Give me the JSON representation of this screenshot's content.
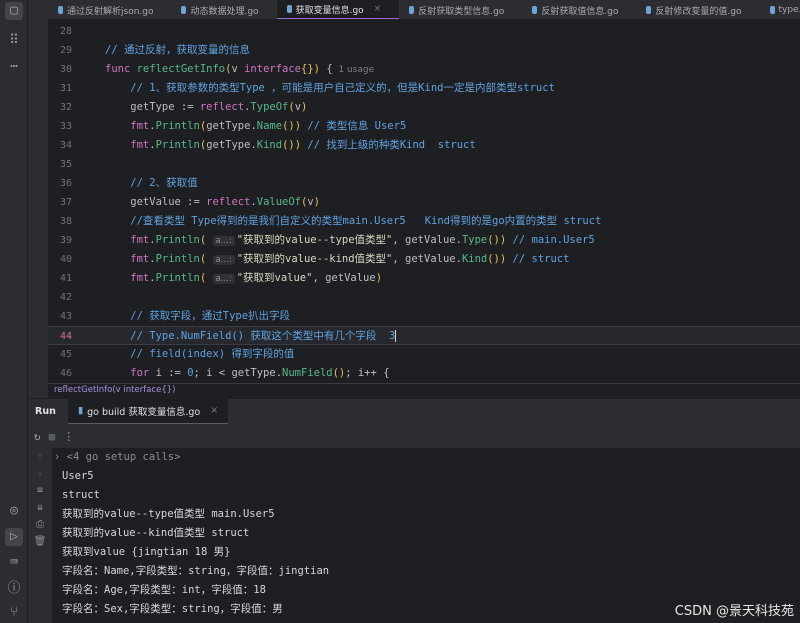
{
  "tabs": [
    {
      "label": "通过反射解析json.go",
      "active": false
    },
    {
      "label": "动态数据处理.go",
      "active": false
    },
    {
      "label": "获取变量信息.go",
      "active": true
    },
    {
      "label": "反射获取类型信息.go",
      "active": false
    },
    {
      "label": "反射获取值信息.go",
      "active": false
    },
    {
      "label": "反射修改变量的值.go",
      "active": false
    },
    {
      "label": "type.go",
      "active": false
    }
  ],
  "tab_close": "×",
  "code": [
    {
      "n": "28",
      "tokens": []
    },
    {
      "n": "29",
      "tokens": [
        [
          "// 通过反射，获取变量的信息",
          "c"
        ]
      ]
    },
    {
      "n": "30",
      "tokens": [
        [
          "func ",
          "k"
        ],
        [
          "reflectGetInfo",
          "f"
        ],
        [
          "(",
          "p"
        ],
        [
          "v ",
          "t"
        ],
        [
          "interface",
          "k"
        ],
        [
          "{}",
          "p"
        ],
        [
          ")",
          "p"
        ],
        [
          " {",
          "t"
        ],
        [
          "  1 usage",
          "h"
        ]
      ]
    },
    {
      "n": "31",
      "tokens": [
        [
          "    // 1、获取参数的类型Type ，可能是用户自己定义的，但是Kind一定是内部类型struct",
          "c"
        ]
      ]
    },
    {
      "n": "32",
      "tokens": [
        [
          "    getType := ",
          "t"
        ],
        [
          "reflect",
          "k"
        ],
        [
          ".",
          "t"
        ],
        [
          "TypeOf",
          "f"
        ],
        [
          "(",
          "p"
        ],
        [
          "v",
          "t"
        ],
        [
          ")",
          "p"
        ]
      ]
    },
    {
      "n": "33",
      "tokens": [
        [
          "    fmt",
          "k"
        ],
        [
          ".",
          "t"
        ],
        [
          "Println",
          "f"
        ],
        [
          "(",
          "p"
        ],
        [
          "getType.",
          "t"
        ],
        [
          "Name",
          "f"
        ],
        [
          "()",
          "p"
        ],
        [
          ")",
          "p"
        ],
        [
          " // 类型信息 User5",
          "c"
        ]
      ]
    },
    {
      "n": "34",
      "tokens": [
        [
          "    fmt",
          "k"
        ],
        [
          ".",
          "t"
        ],
        [
          "Println",
          "f"
        ],
        [
          "(",
          "p"
        ],
        [
          "getType.",
          "t"
        ],
        [
          "Kind",
          "f"
        ],
        [
          "()",
          "p"
        ],
        [
          ")",
          "p"
        ],
        [
          " // 找到上级的种类Kind  struct",
          "c"
        ]
      ]
    },
    {
      "n": "35",
      "tokens": []
    },
    {
      "n": "36",
      "tokens": [
        [
          "    // 2、获取值",
          "c"
        ]
      ]
    },
    {
      "n": "37",
      "tokens": [
        [
          "    getValue := ",
          "t"
        ],
        [
          "reflect",
          "k"
        ],
        [
          ".",
          "t"
        ],
        [
          "ValueOf",
          "f"
        ],
        [
          "(",
          "p"
        ],
        [
          "v",
          "t"
        ],
        [
          ")",
          "p"
        ]
      ]
    },
    {
      "n": "38",
      "tokens": [
        [
          "    //查看类型 Type得到的是我们自定义的类型main.User5   Kind得到的是go内置的类型 struct",
          "c"
        ]
      ]
    },
    {
      "n": "39",
      "tokens": [
        [
          "    fmt",
          "k"
        ],
        [
          ".",
          "t"
        ],
        [
          "Println",
          "f"
        ],
        [
          "( ",
          "p"
        ],
        [
          "a...:",
          "hint"
        ],
        [
          "\"获取到的value--type值类型\"",
          "s"
        ],
        [
          ", getValue.",
          "t"
        ],
        [
          "Type",
          "f"
        ],
        [
          "()",
          "p"
        ],
        [
          ")",
          "p"
        ],
        [
          " // main.User5",
          "c"
        ]
      ]
    },
    {
      "n": "40",
      "tokens": [
        [
          "    fmt",
          "k"
        ],
        [
          ".",
          "t"
        ],
        [
          "Println",
          "f"
        ],
        [
          "( ",
          "p"
        ],
        [
          "a...:",
          "hint"
        ],
        [
          "\"获取到的value--kind值类型\"",
          "s"
        ],
        [
          ", getValue.",
          "t"
        ],
        [
          "Kind",
          "f"
        ],
        [
          "()",
          "p"
        ],
        [
          ")",
          "p"
        ],
        [
          " // struct",
          "c"
        ]
      ]
    },
    {
      "n": "41",
      "tokens": [
        [
          "    fmt",
          "k"
        ],
        [
          ".",
          "t"
        ],
        [
          "Println",
          "f"
        ],
        [
          "( ",
          "p"
        ],
        [
          "a...:",
          "hint"
        ],
        [
          "\"获取到value\"",
          "s"
        ],
        [
          ", getValue",
          "t"
        ],
        [
          ")",
          "p"
        ]
      ]
    },
    {
      "n": "42",
      "tokens": []
    },
    {
      "n": "43",
      "tokens": [
        [
          "    // 获取字段，通过Type扒出字段",
          "c"
        ]
      ]
    },
    {
      "n": "44",
      "tokens": [
        [
          "    // Type.NumField() 获取这个类型中有几个字段  3",
          "c"
        ],
        [
          "",
          "caret"
        ]
      ],
      "current": true
    },
    {
      "n": "45",
      "tokens": [
        [
          "    // field(index) 得到字段的值",
          "c"
        ]
      ]
    },
    {
      "n": "46",
      "tokens": [
        [
          "    for ",
          "k"
        ],
        [
          "i := ",
          "t"
        ],
        [
          "0",
          "c"
        ],
        [
          "; i < getType.",
          "t"
        ],
        [
          "NumField",
          "f"
        ],
        [
          "()",
          "p"
        ],
        [
          "; i++ {",
          "t"
        ]
      ]
    }
  ],
  "breadcrumb": "reflectGetInfo(v interface{})",
  "run": {
    "label": "Run",
    "tab": "go build 获取变量信息.go",
    "close": "×"
  },
  "console": {
    "collapsed": "<4 go setup calls>",
    "lines": [
      "User5",
      "struct",
      "获取到的value--type值类型 main.User5",
      "获取到的value--kind值类型 struct",
      "获取到value {jingtian 18 男}",
      "字段名：Name,字段类型：string，字段值：jingtian",
      "字段名：Age,字段类型：int，字段值：18",
      "字段名：Sex,字段类型：string，字段值：男"
    ]
  },
  "watermark": "CSDN @景天科技苑"
}
